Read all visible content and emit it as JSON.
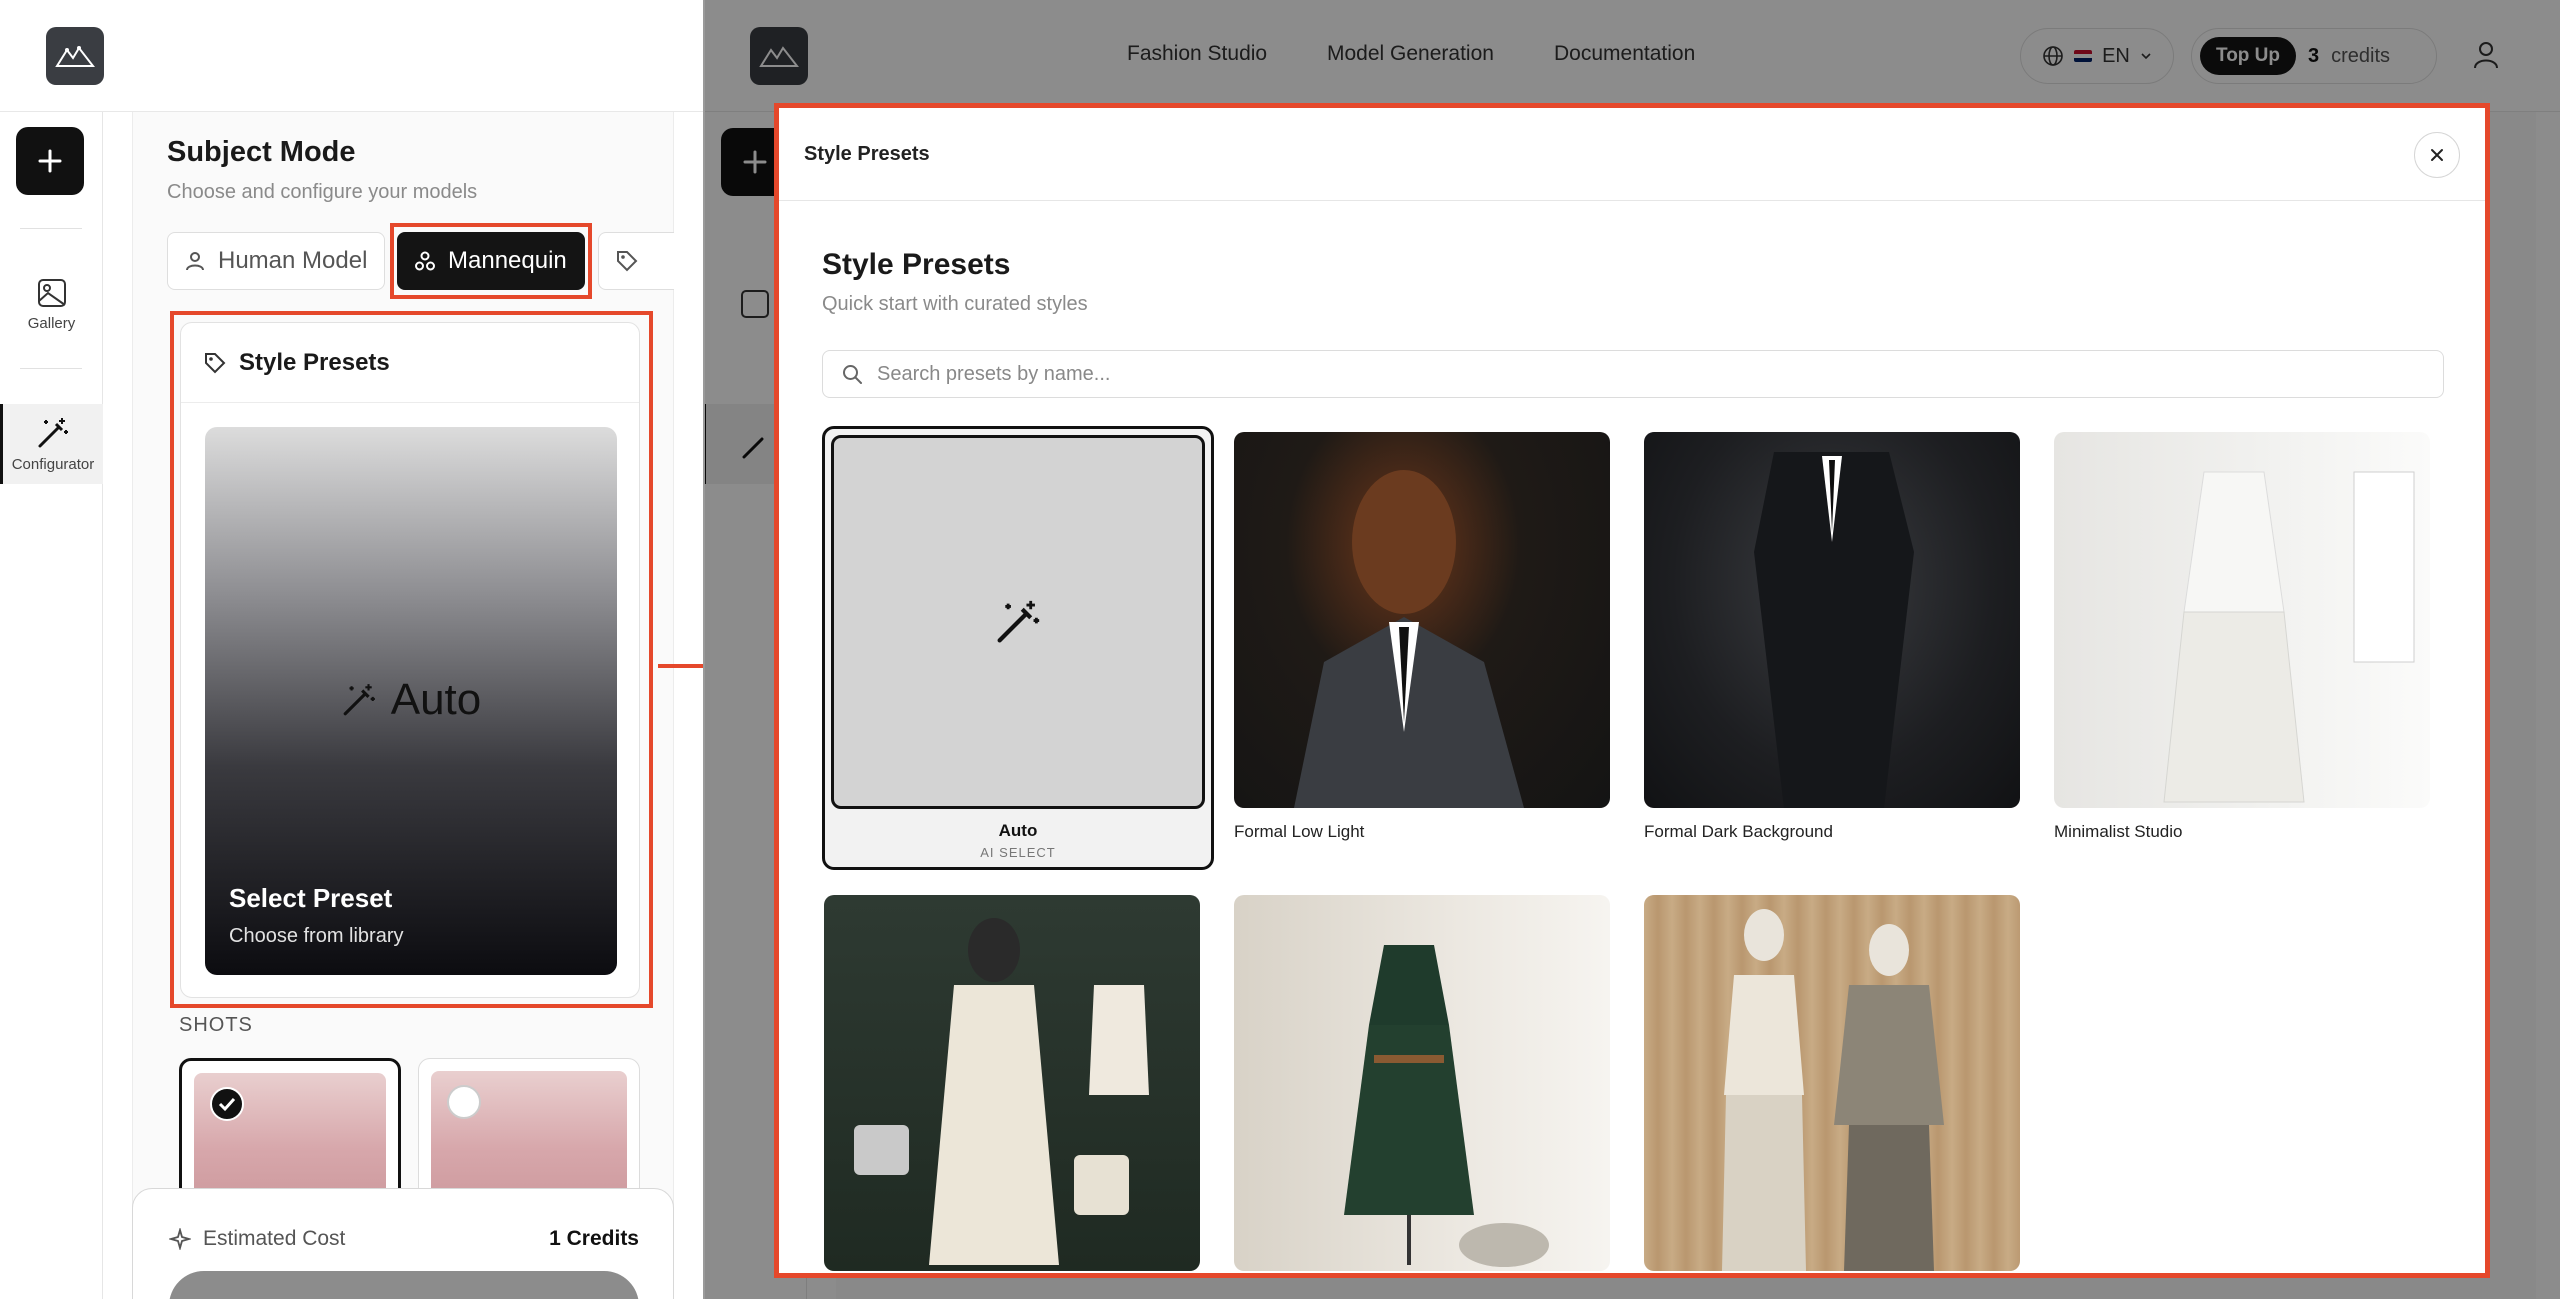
{
  "left": {
    "nav": {
      "gallery": "Gallery",
      "configurator": "Configurator"
    },
    "subject_mode": {
      "title": "Subject Mode",
      "subtitle": "Choose and configure your models",
      "tabs": [
        "Human Model",
        "Mannequin"
      ]
    },
    "style_presets": {
      "title": "Style Presets",
      "auto_label": "Auto",
      "select_title": "Select Preset",
      "select_subtitle": "Choose from library"
    },
    "shots": {
      "label": "SHOTS"
    },
    "cost": {
      "label": "Estimated Cost",
      "value": "1 Credits"
    }
  },
  "right": {
    "nav": [
      "Fashion Studio",
      "Model Generation",
      "Documentation"
    ],
    "lang": "EN",
    "topup": "Top Up",
    "credits_count": "3",
    "credits_label": "credits",
    "modal": {
      "header_title": "Style Presets",
      "title": "Style Presets",
      "subtitle": "Quick start with curated styles",
      "search_placeholder": "Search presets by name...",
      "auto": {
        "name": "Auto",
        "tag": "AI SELECT"
      },
      "presets": [
        {
          "name": "Formal Low Light"
        },
        {
          "name": "Formal Dark Background"
        },
        {
          "name": "Minimalist Studio"
        },
        {
          "name": ""
        },
        {
          "name": ""
        },
        {
          "name": ""
        }
      ]
    }
  },
  "colors": {
    "highlight": "#e5482b",
    "accent_dark": "#141414"
  }
}
